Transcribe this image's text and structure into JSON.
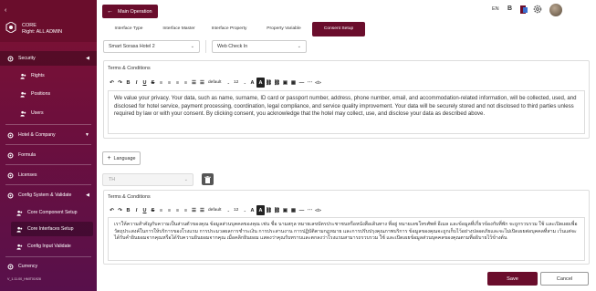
{
  "sidebar": {
    "app_name": "CORE",
    "right": "Right: ALL ADMIN",
    "items": [
      {
        "label": "Security"
      },
      {
        "label": "Rights"
      },
      {
        "label": "Positions"
      },
      {
        "label": "Users"
      },
      {
        "label": "Hotel & Company"
      },
      {
        "label": "Formula"
      },
      {
        "label": "Licenses"
      },
      {
        "label": "Config System & Validate"
      },
      {
        "label": "Core Component Setup"
      },
      {
        "label": "Core Interfaces Setup"
      },
      {
        "label": "Config Input Validate"
      },
      {
        "label": "Currency"
      }
    ],
    "version": "V_1.11.00_HMIT01928"
  },
  "header": {
    "main_operation": "Main Operation",
    "lang": "EN",
    "b_label": "B"
  },
  "tabs": [
    {
      "label": "Interface Type"
    },
    {
      "label": "Interface Master"
    },
    {
      "label": "Interface Property"
    },
    {
      "label": "Property Variable"
    },
    {
      "label": "Consent Setup"
    }
  ],
  "filters": {
    "hotel": "Smart Sorasa Hotel 2",
    "interface": "Web Check In"
  },
  "editor": {
    "label": "Terms & Conditions",
    "font_select": "default",
    "size_select": "12",
    "content_en": "We value your privacy. Your data, such as name, surname, ID card or passport number, address, phone number, email, and accommodation-related information, will be collected, used, and disclosed for hotel service, payment processing, coordination, legal compliance, and service quality improvement. Your data will be securely stored and not disclosed to third parties unless required by law or with your consent. By clicking consent, you acknowledge that the hotel may collect, use, and disclose your data as described above.",
    "content_th": "เราให้ความสำคัญกับความเป็นส่วนตัวของคุณ ข้อมูลส่วนบุคคลของคุณ เช่น ชื่อ นามสกุล หมายเลขบัตรประชาชนหรือหนังสือเดินทาง ที่อยู่ หมายเลขโทรศัพท์ อีเมล และข้อมูลที่เกี่ยวข้องกับที่พัก จะถูกรวบรวม ใช้ และเปิดเผยเพื่อวัตถุประสงค์ในการให้บริการของโรงแรม การประมวลผลการชำระเงิน การประสานงาน การปฏิบัติตามกฎหมาย และการปรับปรุงคุณภาพบริการ ข้อมูลของคุณจะถูกเก็บไว้อย่างปลอดภัยและจะไม่เปิดเผยต่อบุคคลที่สาม เว้นแต่จะได้รับคำยินยอมจากคุณหรือได้รับความยินยอมจากคุณ เมื่อคลิกยินยอม แสดงว่าคุณรับทราบและตกลงว่าโรงแรมสามารถรวบรวม ใช้ และเปิดเผยข้อมูลส่วนบุคคลของคุณตามที่อธิบายไว้ข้างต้น"
  },
  "language_button": "Language",
  "language_select": "TH",
  "actions": {
    "save": "Save",
    "cancel": "Cancel"
  },
  "colors": {
    "brand": "#6a0d2c"
  }
}
